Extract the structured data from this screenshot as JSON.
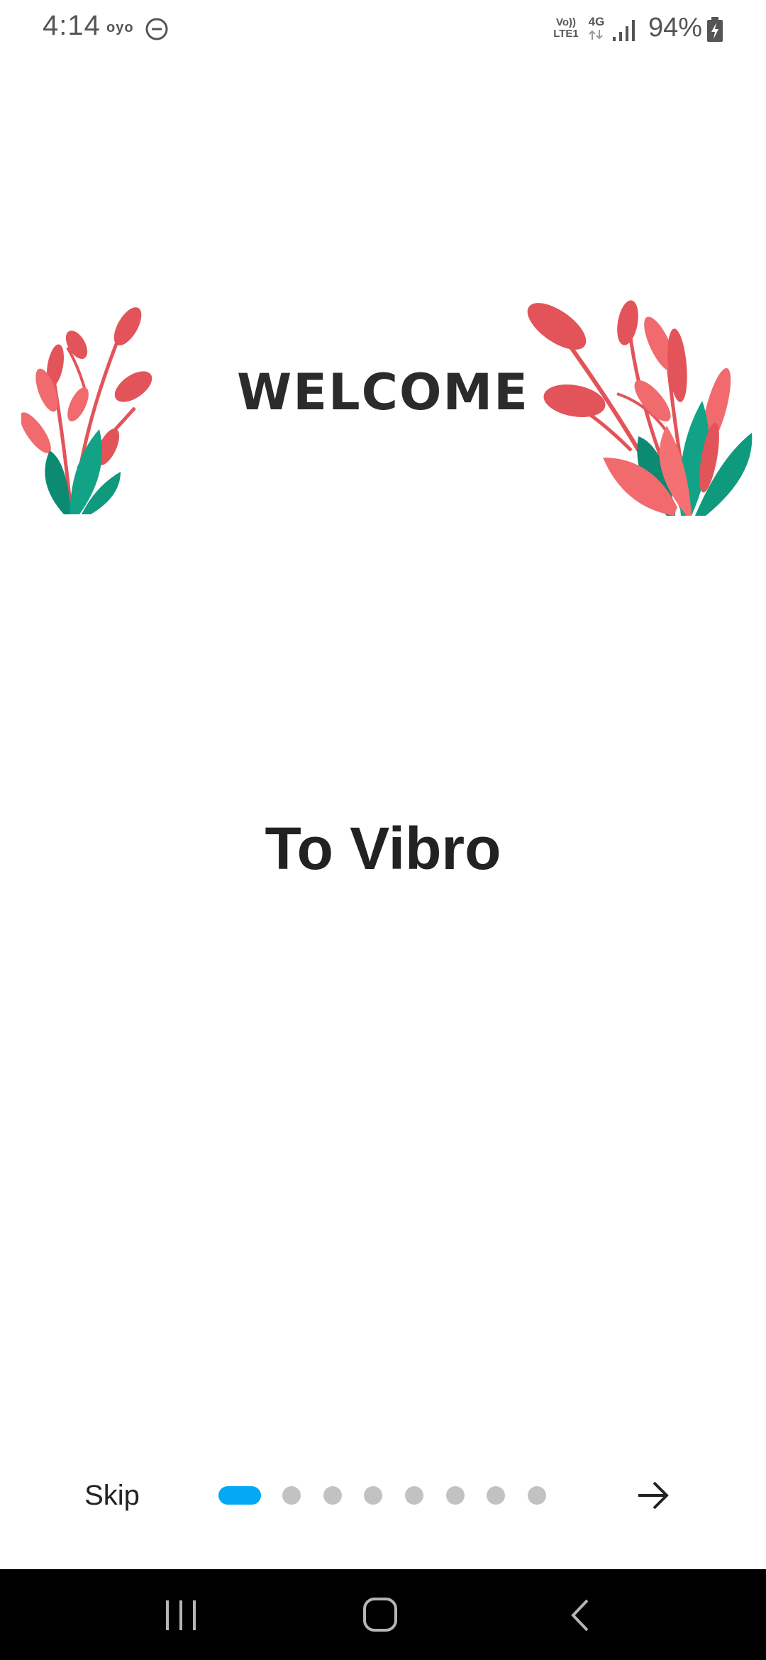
{
  "status_bar": {
    "time": "4:14",
    "carrier_logo": "oyo",
    "volte_line1": "Vo))",
    "volte_line2": "LTE1",
    "network": "4G",
    "battery": "94%",
    "icons": [
      "dnd-icon",
      "volte-icon",
      "4g-icon",
      "signal-icon",
      "battery-charging-icon"
    ]
  },
  "main": {
    "title": "WELCOME",
    "subtitle": "To Vibro"
  },
  "onboarding": {
    "skip_label": "Skip",
    "page_count": 8,
    "current_page": 1,
    "next_icon": "arrow-right-icon",
    "accent_color": "#03a9f4",
    "inactive_color": "#c2c2c2"
  },
  "nav_bar": {
    "icons": [
      "recents-icon",
      "home-icon",
      "back-icon"
    ]
  },
  "colors": {
    "leaf_red": "#e25459",
    "leaf_green": "#0f9a7e"
  }
}
